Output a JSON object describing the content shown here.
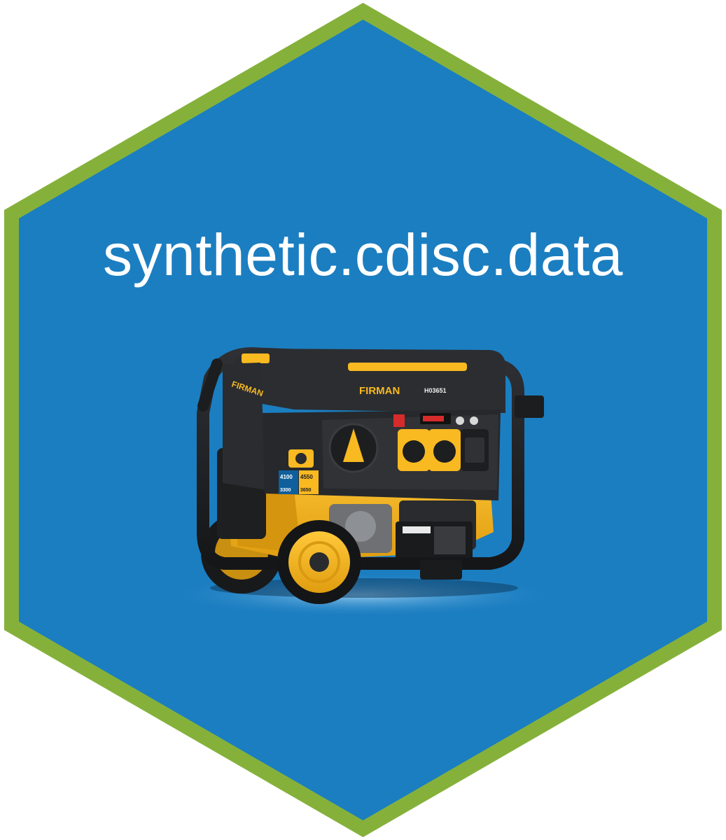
{
  "title": "synthetic.cdisc.data",
  "colors": {
    "hex_fill": "#1b7ec1",
    "hex_border": "#85b13b",
    "title_text": "#ffffff",
    "generator_frame": "#1c1d1f",
    "generator_accent": "#f8b921",
    "generator_panel": "#2b2d31"
  },
  "generator": {
    "brand": "FIRMAN",
    "model": "H03651",
    "rating_running": "4100",
    "rating_starting": "4550",
    "rating_running_alt": "3300",
    "rating_starting_alt": "3650"
  }
}
